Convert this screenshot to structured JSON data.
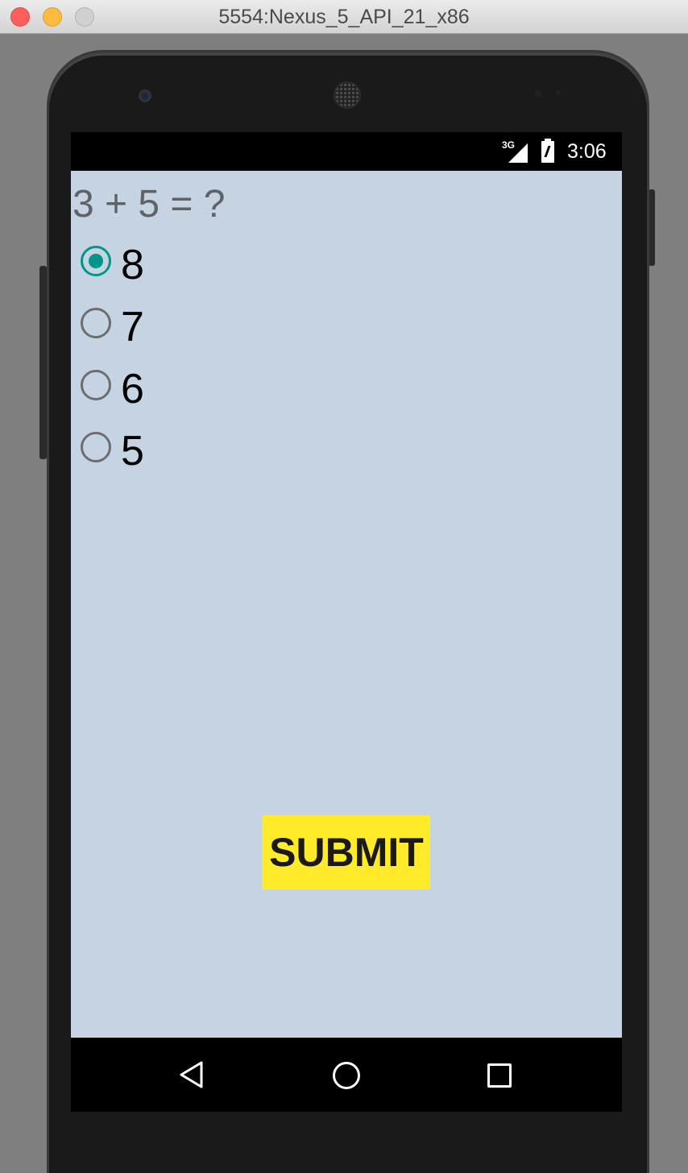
{
  "window": {
    "title": "5554:Nexus_5_API_21_x86"
  },
  "status_bar": {
    "network": "3G",
    "time": "3:06"
  },
  "quiz": {
    "question": "3 + 5 = ?",
    "options": [
      {
        "label": "8",
        "selected": true
      },
      {
        "label": "7",
        "selected": false
      },
      {
        "label": "6",
        "selected": false
      },
      {
        "label": "5",
        "selected": false
      }
    ],
    "submit_label": "SUBMIT"
  },
  "colors": {
    "screen_background": "#c6d3e3",
    "radio_accent": "#009688",
    "submit_background": "#ffeb2a"
  },
  "icons": {
    "nav_back": "back-triangle-icon",
    "nav_home": "home-circle-icon",
    "nav_recents": "recents-square-icon"
  }
}
